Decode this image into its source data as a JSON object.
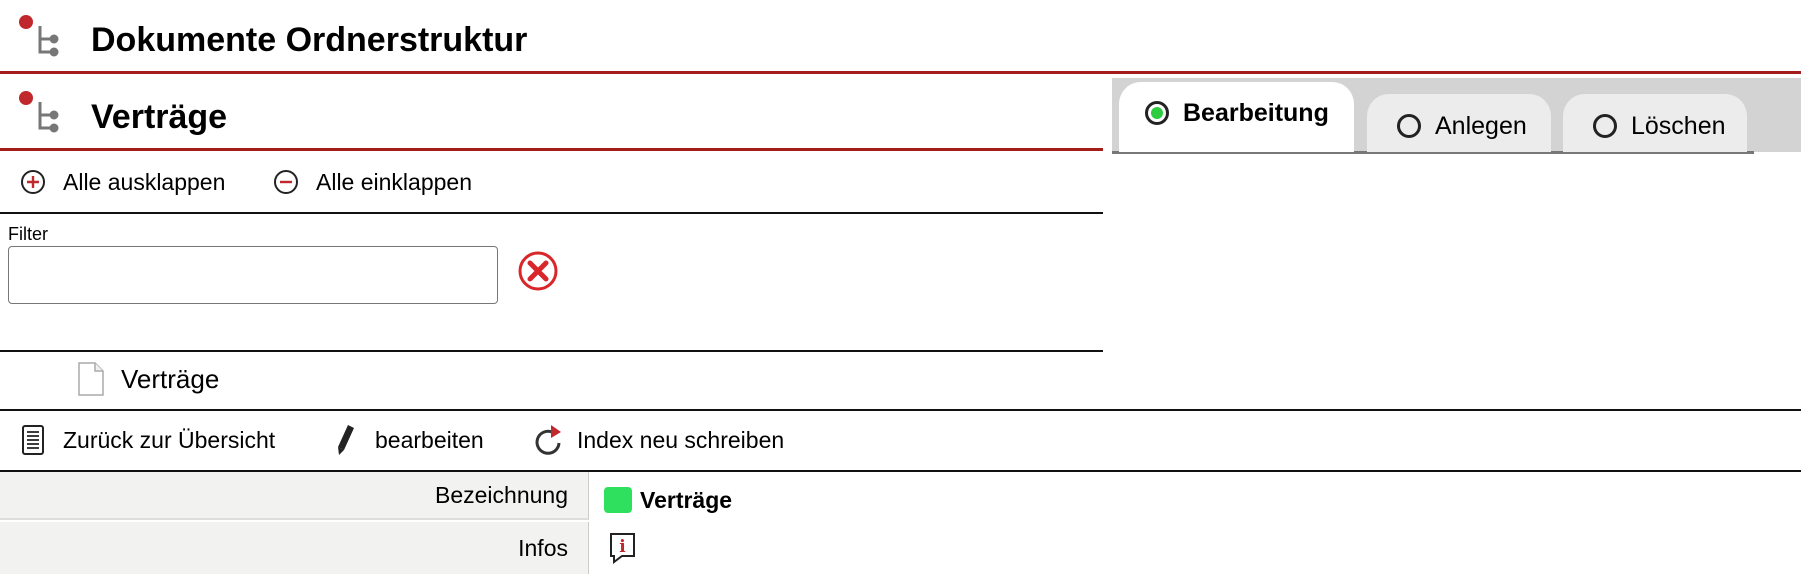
{
  "header": {
    "title": "Dokumente Ordnerstruktur",
    "icon": "tree-structure-icon"
  },
  "section": {
    "title": "Verträge",
    "icon": "tree-structure-icon"
  },
  "tree_actions": {
    "expand_all": "Alle ausklappen",
    "collapse_all": "Alle einklappen"
  },
  "filter": {
    "label": "Filter",
    "value": "",
    "placeholder": ""
  },
  "tree": {
    "items": [
      {
        "label": "Verträge",
        "icon": "document-icon"
      }
    ]
  },
  "tabs": [
    {
      "label": "Bearbeitung",
      "selected": true
    },
    {
      "label": "Anlegen",
      "selected": false
    },
    {
      "label": "Löschen",
      "selected": false
    }
  ],
  "toolbar": {
    "back": "Zurück zur Übersicht",
    "edit": "bearbeiten",
    "reindex": "Index neu schreiben"
  },
  "details": {
    "rows": [
      {
        "label": "Bezeichnung",
        "value": "Verträge",
        "color": "#2fe05e"
      },
      {
        "label": "Infos",
        "value": ""
      }
    ]
  },
  "colors": {
    "accent": "#a31d1d",
    "active_radio": "#2ecc40",
    "delete_icon": "#d9262b"
  }
}
